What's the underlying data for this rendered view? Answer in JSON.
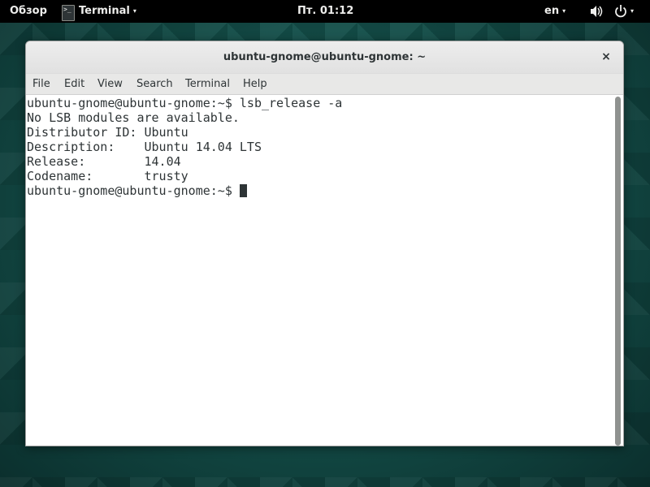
{
  "topbar": {
    "activities": "Обзор",
    "app_icon_glyph": ">_",
    "app_name": "Terminal",
    "clock": "Пт. 01:12",
    "language": "en",
    "caret": "▾",
    "volume_icon": "🔊",
    "power_icon": "⏻"
  },
  "window": {
    "title": "ubuntu-gnome@ubuntu-gnome: ~",
    "close_icon": "×",
    "menu": [
      "File",
      "Edit",
      "View",
      "Search",
      "Terminal",
      "Help"
    ]
  },
  "terminal": {
    "lines": [
      "ubuntu-gnome@ubuntu-gnome:~$ lsb_release -a",
      "No LSB modules are available.",
      "Distributor ID: Ubuntu",
      "Description:    Ubuntu 14.04 LTS",
      "Release:        14.04",
      "Codename:       trusty",
      "ubuntu-gnome@ubuntu-gnome:~$ "
    ]
  }
}
